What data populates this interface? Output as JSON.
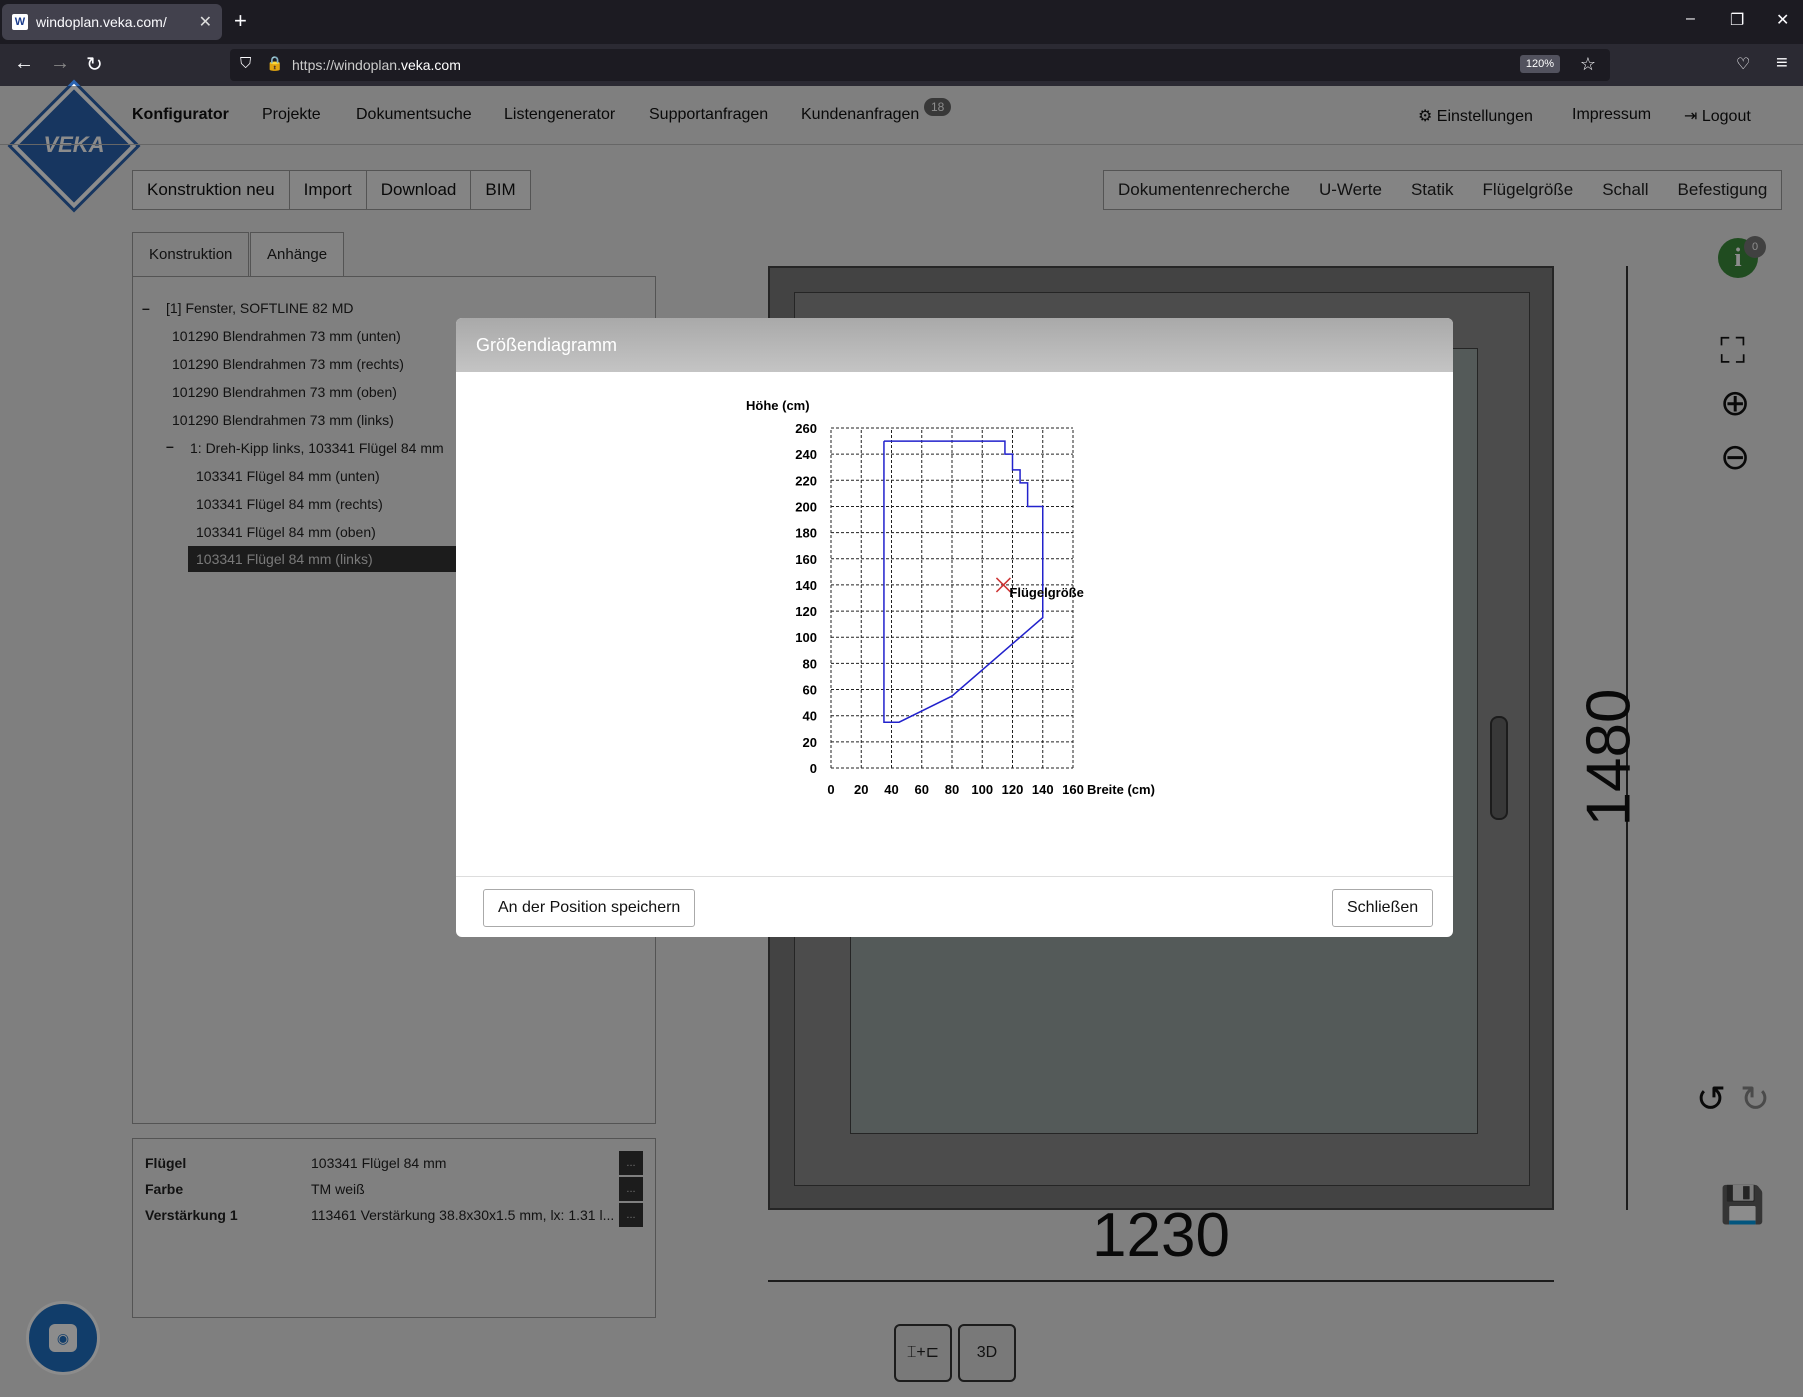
{
  "browser": {
    "tab_title": "windoplan.veka.com/",
    "tab_favicon": "W",
    "url_prefix": "https://windoplan.",
    "url_domain": "veka.com",
    "zoom": "120%"
  },
  "nav": {
    "logo_text": "VEKA",
    "items": [
      "Konfigurator",
      "Projekte",
      "Dokumentsuche",
      "Listengenerator",
      "Supportanfragen",
      "Kundenanfragen"
    ],
    "kundenanfragen_badge": "18",
    "right": [
      "Einstellungen",
      "Impressum",
      "Logout"
    ]
  },
  "toolbar": {
    "left": [
      "Konstruktion neu",
      "Import",
      "Download",
      "BIM"
    ],
    "right": [
      "Dokumentenrecherche",
      "U-Werte",
      "Statik",
      "Flügelgröße",
      "Schall",
      "Befestigung"
    ]
  },
  "panel_tabs": [
    "Konstruktion",
    "Anhänge"
  ],
  "tree": [
    "[1] Fenster, SOFTLINE 82 MD",
    "101290 Blendrahmen 73 mm (unten)",
    "101290 Blendrahmen 73 mm (rechts)",
    "101290 Blendrahmen 73 mm (oben)",
    "101290 Blendrahmen 73 mm (links)",
    "1: Dreh-Kipp links, 103341 Flügel 84 mm",
    "103341 Flügel 84 mm (unten)",
    "103341 Flügel 84 mm (rechts)",
    "103341 Flügel 84 mm (oben)",
    "103341 Flügel 84 mm (links)"
  ],
  "properties": [
    {
      "label": "Flügel",
      "value": "103341 Flügel 84 mm"
    },
    {
      "label": "Farbe",
      "value": "TM weiß"
    },
    {
      "label": "Verstärkung 1",
      "value": "113461 Verstärkung 38.8x30x1.5 mm, lx: 1.31 l..."
    }
  ],
  "drawing": {
    "width_label": "1230",
    "height_label": "1480",
    "info_count": "0"
  },
  "modal": {
    "title": "Größendiagramm",
    "save_button": "An der Position speichern",
    "close_button": "Schließen"
  },
  "chart_data": {
    "type": "line",
    "ylabel": "Höhe (cm)",
    "xlabel": "Breite (cm)",
    "xlim": [
      0,
      160
    ],
    "ylim": [
      0,
      260
    ],
    "x_ticks": [
      0,
      20,
      40,
      60,
      80,
      100,
      120,
      140,
      160
    ],
    "y_ticks": [
      0,
      20,
      40,
      60,
      80,
      100,
      120,
      140,
      160,
      180,
      200,
      220,
      240,
      260
    ],
    "grid": true,
    "boundary_color": "#2222cc",
    "series": [
      {
        "values": [
          [
            35,
            250
          ],
          [
            115,
            250
          ],
          [
            115,
            240
          ],
          [
            120,
            240
          ],
          [
            120,
            228
          ],
          [
            125,
            228
          ],
          [
            125,
            218
          ],
          [
            130,
            218
          ],
          [
            130,
            200
          ],
          [
            140,
            200
          ],
          [
            140,
            115
          ],
          [
            80,
            55
          ],
          [
            45,
            35
          ],
          [
            35,
            35
          ],
          [
            35,
            250
          ]
        ]
      }
    ],
    "marker": {
      "x": 114,
      "y": 140,
      "label": "Flügelgröße",
      "color": "#cc3333"
    }
  },
  "colors": {
    "accent": "#2b63b0",
    "chat": "#1f6fc1",
    "info": "#3b8a3b"
  }
}
